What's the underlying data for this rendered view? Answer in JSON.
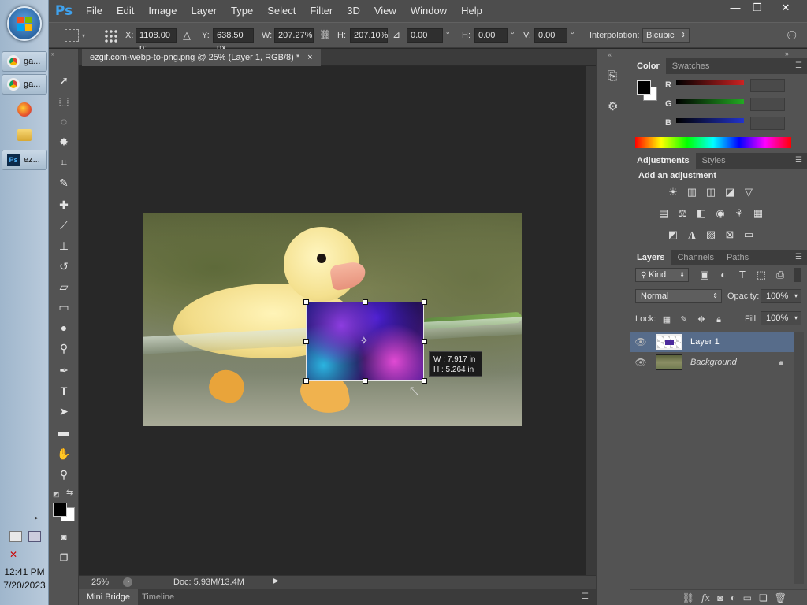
{
  "taskbar": {
    "items": [
      {
        "label": "ga..."
      },
      {
        "label": "ga..."
      },
      {
        "label": "ez..."
      }
    ],
    "time": "12:41 PM",
    "date": "7/20/2023"
  },
  "app": {
    "logo": "Ps"
  },
  "menu": [
    "File",
    "Edit",
    "Image",
    "Layer",
    "Type",
    "Select",
    "Filter",
    "3D",
    "View",
    "Window",
    "Help"
  ],
  "window_controls": {
    "minimize": "—",
    "restore": "❐",
    "close": "✕"
  },
  "options": {
    "x_label": "X:",
    "x_value": "1108.00 p:",
    "y_label": "Y:",
    "y_value": "638.50 px",
    "w_label": "W:",
    "w_value": "207.27%",
    "h_label": "H:",
    "h_value": "207.10%",
    "angle_value": "0.00",
    "degree": "°",
    "hskew_label": "H:",
    "hskew_value": "0.00",
    "vskew_label": "V:",
    "vskew_value": "0.00",
    "interp_label": "Interpolation:",
    "interp_value": "Bicubic"
  },
  "document": {
    "tab_title": "ezgif.com-webp-to-png.png @ 25% (Layer 1, RGB/8) *",
    "tab_close": "×",
    "tooltip_w": "W :  7.917 in",
    "tooltip_h": "H :  5.264 in",
    "zoom": "25%",
    "doc_info": "Doc: 5.93M/13.4M"
  },
  "bottom_tabs": [
    "Mini Bridge",
    "Timeline"
  ],
  "color_panel": {
    "tabs": [
      "Color",
      "Swatches"
    ],
    "channels": [
      {
        "label": "R",
        "color": "#cc2222"
      },
      {
        "label": "G",
        "color": "#22aa22"
      },
      {
        "label": "B",
        "color": "#2233cc"
      }
    ]
  },
  "adjustments_panel": {
    "tabs": [
      "Adjustments",
      "Styles"
    ],
    "heading": "Add an adjustment"
  },
  "layers_panel": {
    "tabs": [
      "Layers",
      "Channels",
      "Paths"
    ],
    "kind": "Kind",
    "blend_mode": "Normal",
    "opacity_label": "Opacity:",
    "opacity_value": "100%",
    "lock_label": "Lock:",
    "fill_label": "Fill:",
    "fill_value": "100%",
    "layers": [
      {
        "name": "Layer 1",
        "selected": true
      },
      {
        "name": "Background",
        "selected": false,
        "locked": true
      }
    ]
  },
  "colors": {
    "accent": "#3fa2ee",
    "panel": "#535353",
    "canvas": "#282828"
  }
}
